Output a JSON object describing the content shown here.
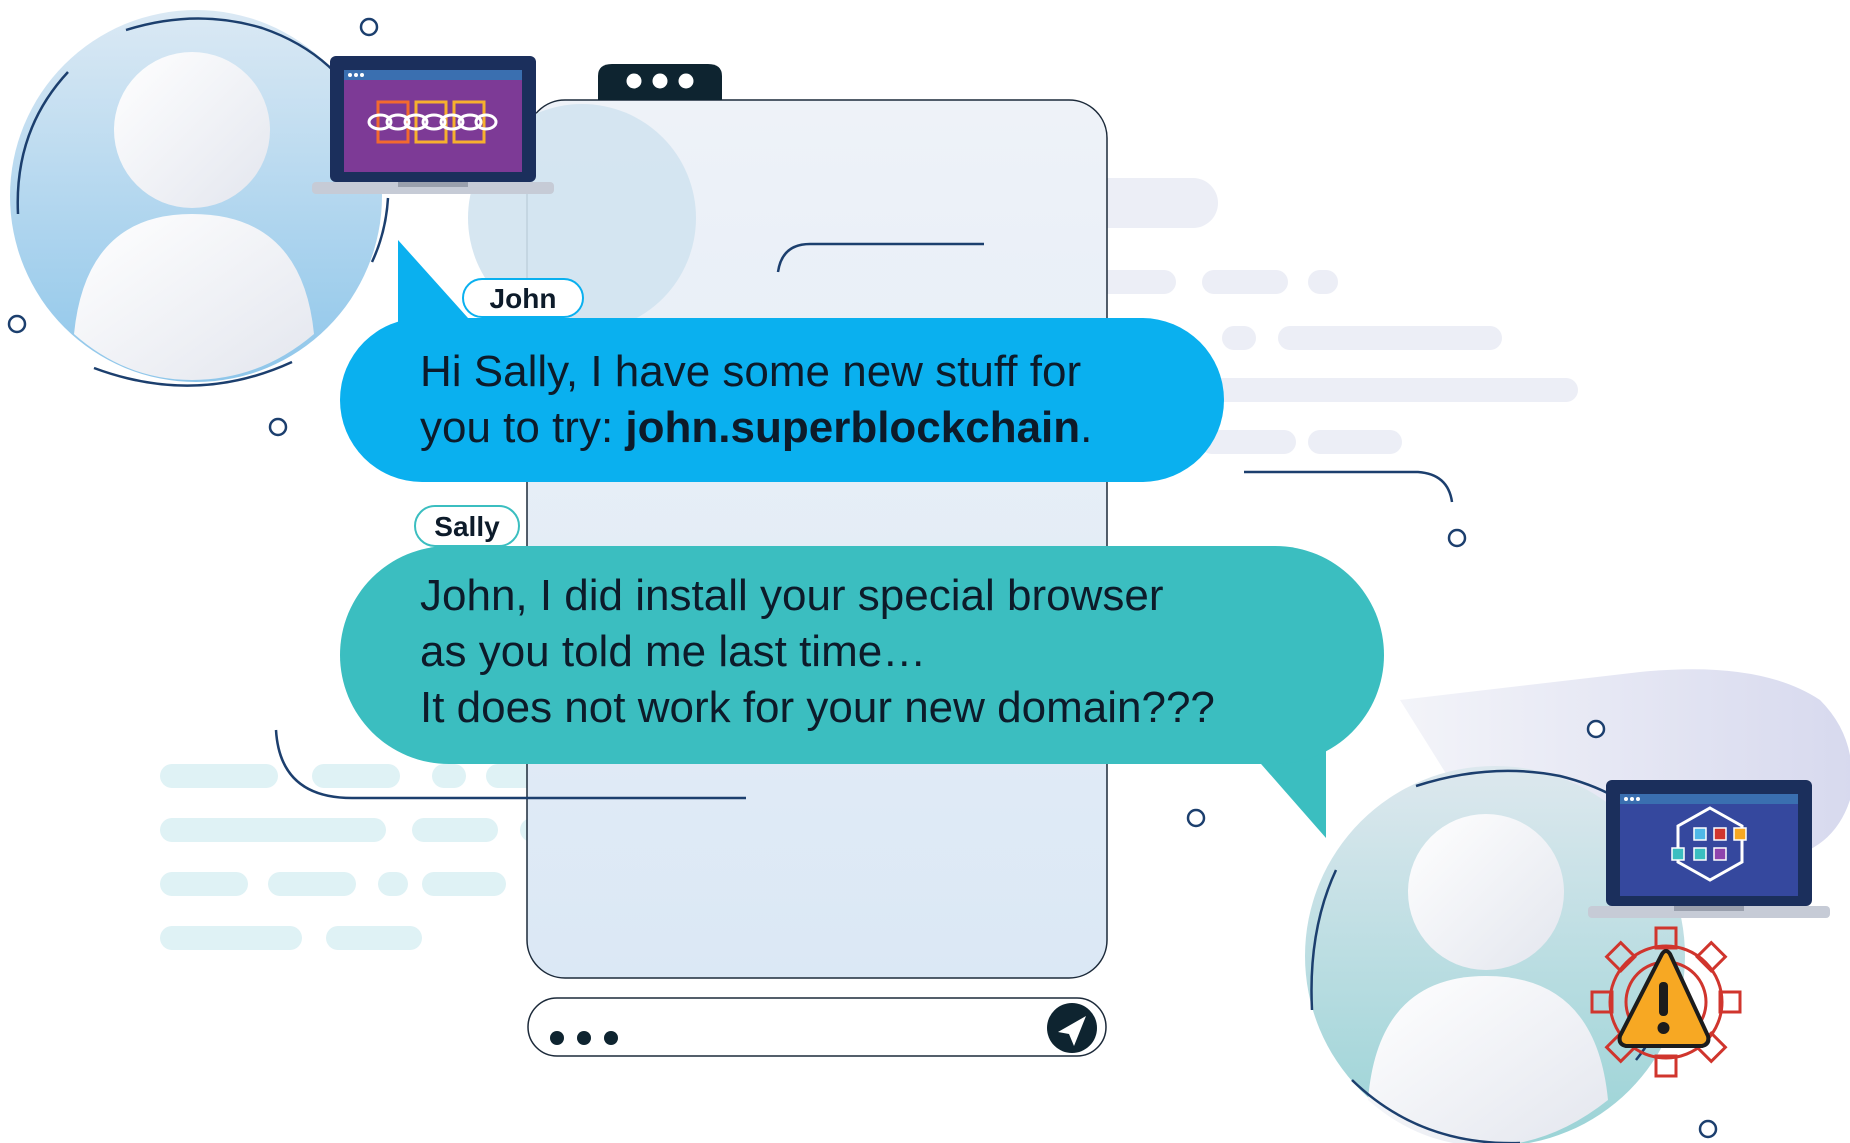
{
  "chat": {
    "john": {
      "name": "John",
      "message_prefix": "Hi Sally, I have some new stuff for",
      "message_line2_prefix": "you to try: ",
      "message_link": "john.superblockchain",
      "message_suffix": "."
    },
    "sally": {
      "name": "Sally",
      "message_lines": [
        "John, I did install your special browser",
        "as you told me last time…",
        "It does not work for your new domain???"
      ]
    }
  },
  "input_bar": {
    "icons": [
      "typing-dots-icon",
      "send-plane-icon"
    ]
  },
  "colors": {
    "john_bubble": "#0ab0ef",
    "sally_bubble": "#3bbec0",
    "outline": "#1c3f6e",
    "warning": "#f7a823",
    "gear": "#d0352d",
    "john_screen": "#7d3a96",
    "sally_screen": "#35489e"
  }
}
